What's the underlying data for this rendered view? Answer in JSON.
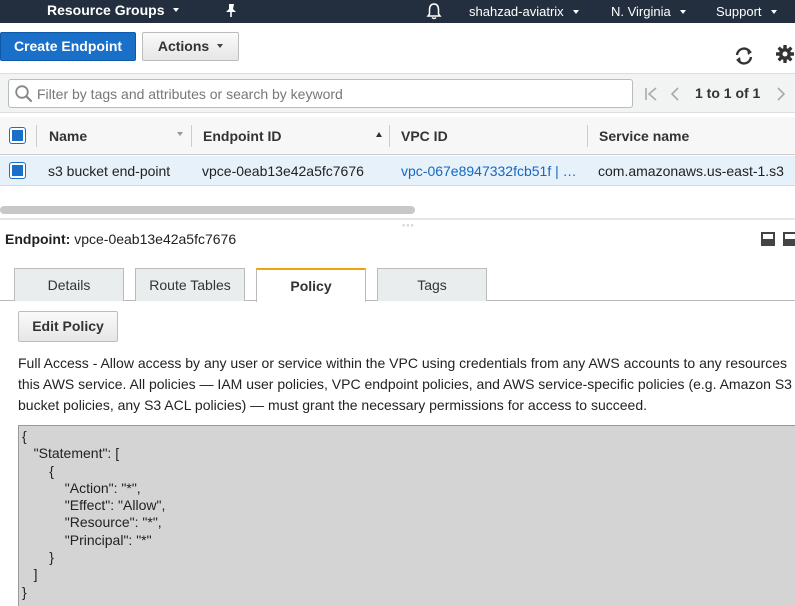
{
  "topnav": {
    "resource_groups": "Resource Groups",
    "user": "shahzad-aviatrix",
    "region": "N. Virginia",
    "support": "Support"
  },
  "toolbar": {
    "create_label": "Create Endpoint",
    "actions_label": "Actions"
  },
  "filter": {
    "placeholder": "Filter by tags and attributes or search by keyword",
    "pager_text": "1 to 1 of 1"
  },
  "table": {
    "columns": [
      "Name",
      "Endpoint ID",
      "VPC ID",
      "Service name"
    ],
    "rows": [
      {
        "name": "s3 bucket end-point",
        "endpoint_id": "vpce-0eab13e42a5fc7676",
        "vpc_id": "vpc-067e8947332fcb51f | …",
        "service_name": "com.amazonaws.us-east-1.s3"
      }
    ]
  },
  "details": {
    "label": "Endpoint:",
    "endpoint_id": "vpce-0eab13e42a5fc7676",
    "tabs": [
      "Details",
      "Route Tables",
      "Policy",
      "Tags"
    ],
    "active_tab": "Policy",
    "edit_label": "Edit Policy",
    "description": [
      "Full Access - Allow access by any user or service within the VPC using credentials from any AWS accounts to any resources",
      "this AWS service. All policies — IAM user policies, VPC endpoint policies, and AWS service-specific policies (e.g. Amazon S3",
      "bucket policies, any S3 ACL policies) — must grant the necessary permissions for access to succeed."
    ],
    "policy_json": "{\n   \"Statement\": [\n       {\n           \"Action\": \"*\",\n           \"Effect\": \"Allow\",\n           \"Resource\": \"*\",\n           \"Principal\": \"*\"\n       }\n   ]\n}"
  },
  "colors": {
    "nav_bg": "#232f3e",
    "primary": "#1a6fc9",
    "link": "#1568c2",
    "active_tab_accent": "#f0a30a",
    "selected_row": "#e6f1fa"
  }
}
